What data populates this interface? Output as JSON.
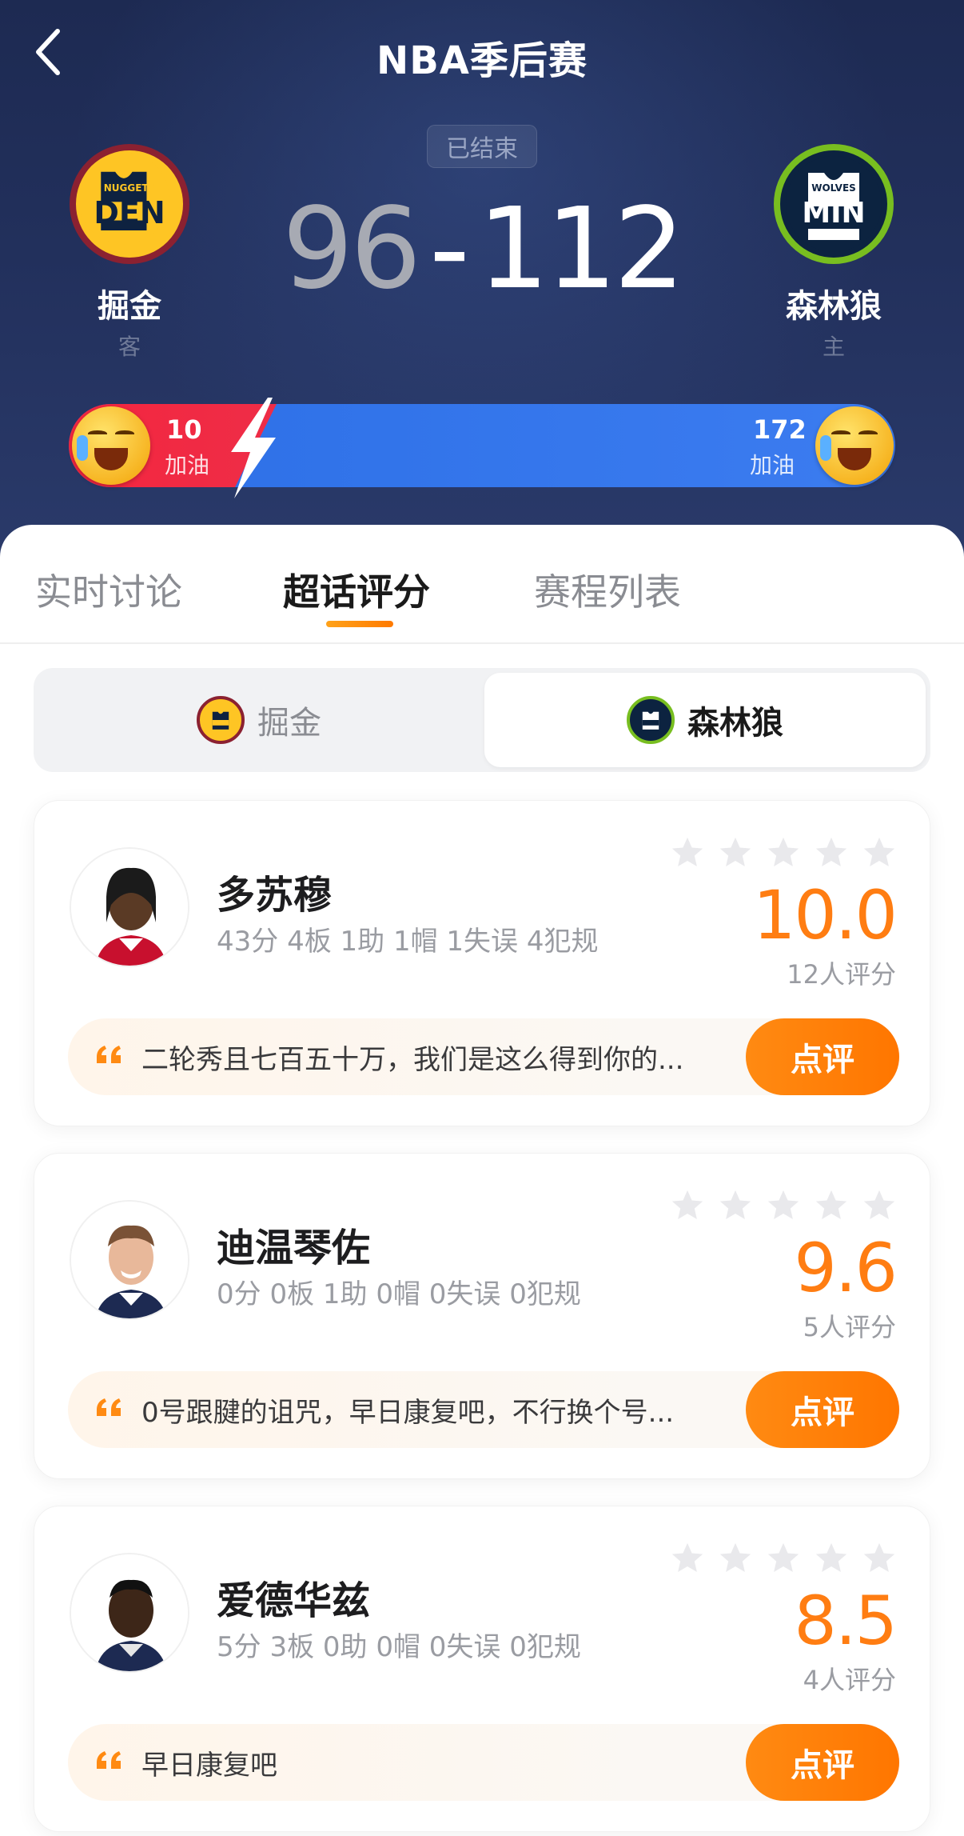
{
  "header": {
    "title": "NBA季后赛",
    "status": "已结束"
  },
  "score": {
    "away": "96",
    "separator": "-",
    "home": "112"
  },
  "teams": {
    "away": {
      "name": "掘金",
      "role": "客",
      "abbr": "DEN",
      "wordmark": "NUGGETS",
      "color": "#0e2240",
      "accent": "#fec524",
      "ring": "#8b2131"
    },
    "home": {
      "name": "森林狼",
      "role": "主",
      "abbr": "MIN",
      "wordmark": "WOLVES",
      "color": "#0c2340",
      "accent": "#78be20",
      "ring": "#236192"
    }
  },
  "cheer": {
    "away": {
      "count": "10",
      "label": "加油"
    },
    "home": {
      "count": "172",
      "label": "加油"
    }
  },
  "tabs": [
    "实时讨论",
    "超话评分",
    "赛程列表"
  ],
  "segments": {
    "away_label": "掘金",
    "home_label": "森林狼"
  },
  "players": [
    {
      "name": "多苏穆",
      "stats": "43分 4板 1助 1帽 1失误 4犯规",
      "rating": "10.0",
      "rating_count": "12人评分",
      "comment": "二轮秀且七百五十万，我们是这么得到你的...",
      "review_label": "点评"
    },
    {
      "name": "迪温琴佐",
      "stats": "0分 0板 1助 0帽 0失误 0犯规",
      "rating": "9.6",
      "rating_count": "5人评分",
      "comment": "0号跟腱的诅咒，早日康复吧，不行换个号...",
      "review_label": "点评"
    },
    {
      "name": "爱德华兹",
      "stats": "5分 3板 0助 0帽 0失误 0犯规",
      "rating": "8.5",
      "rating_count": "4人评分",
      "comment": "早日康复吧",
      "review_label": "点评"
    }
  ],
  "colors": {
    "accent": "#ff7d12",
    "away_bar": "#f4263f",
    "home_bar": "#3c7cf0"
  }
}
